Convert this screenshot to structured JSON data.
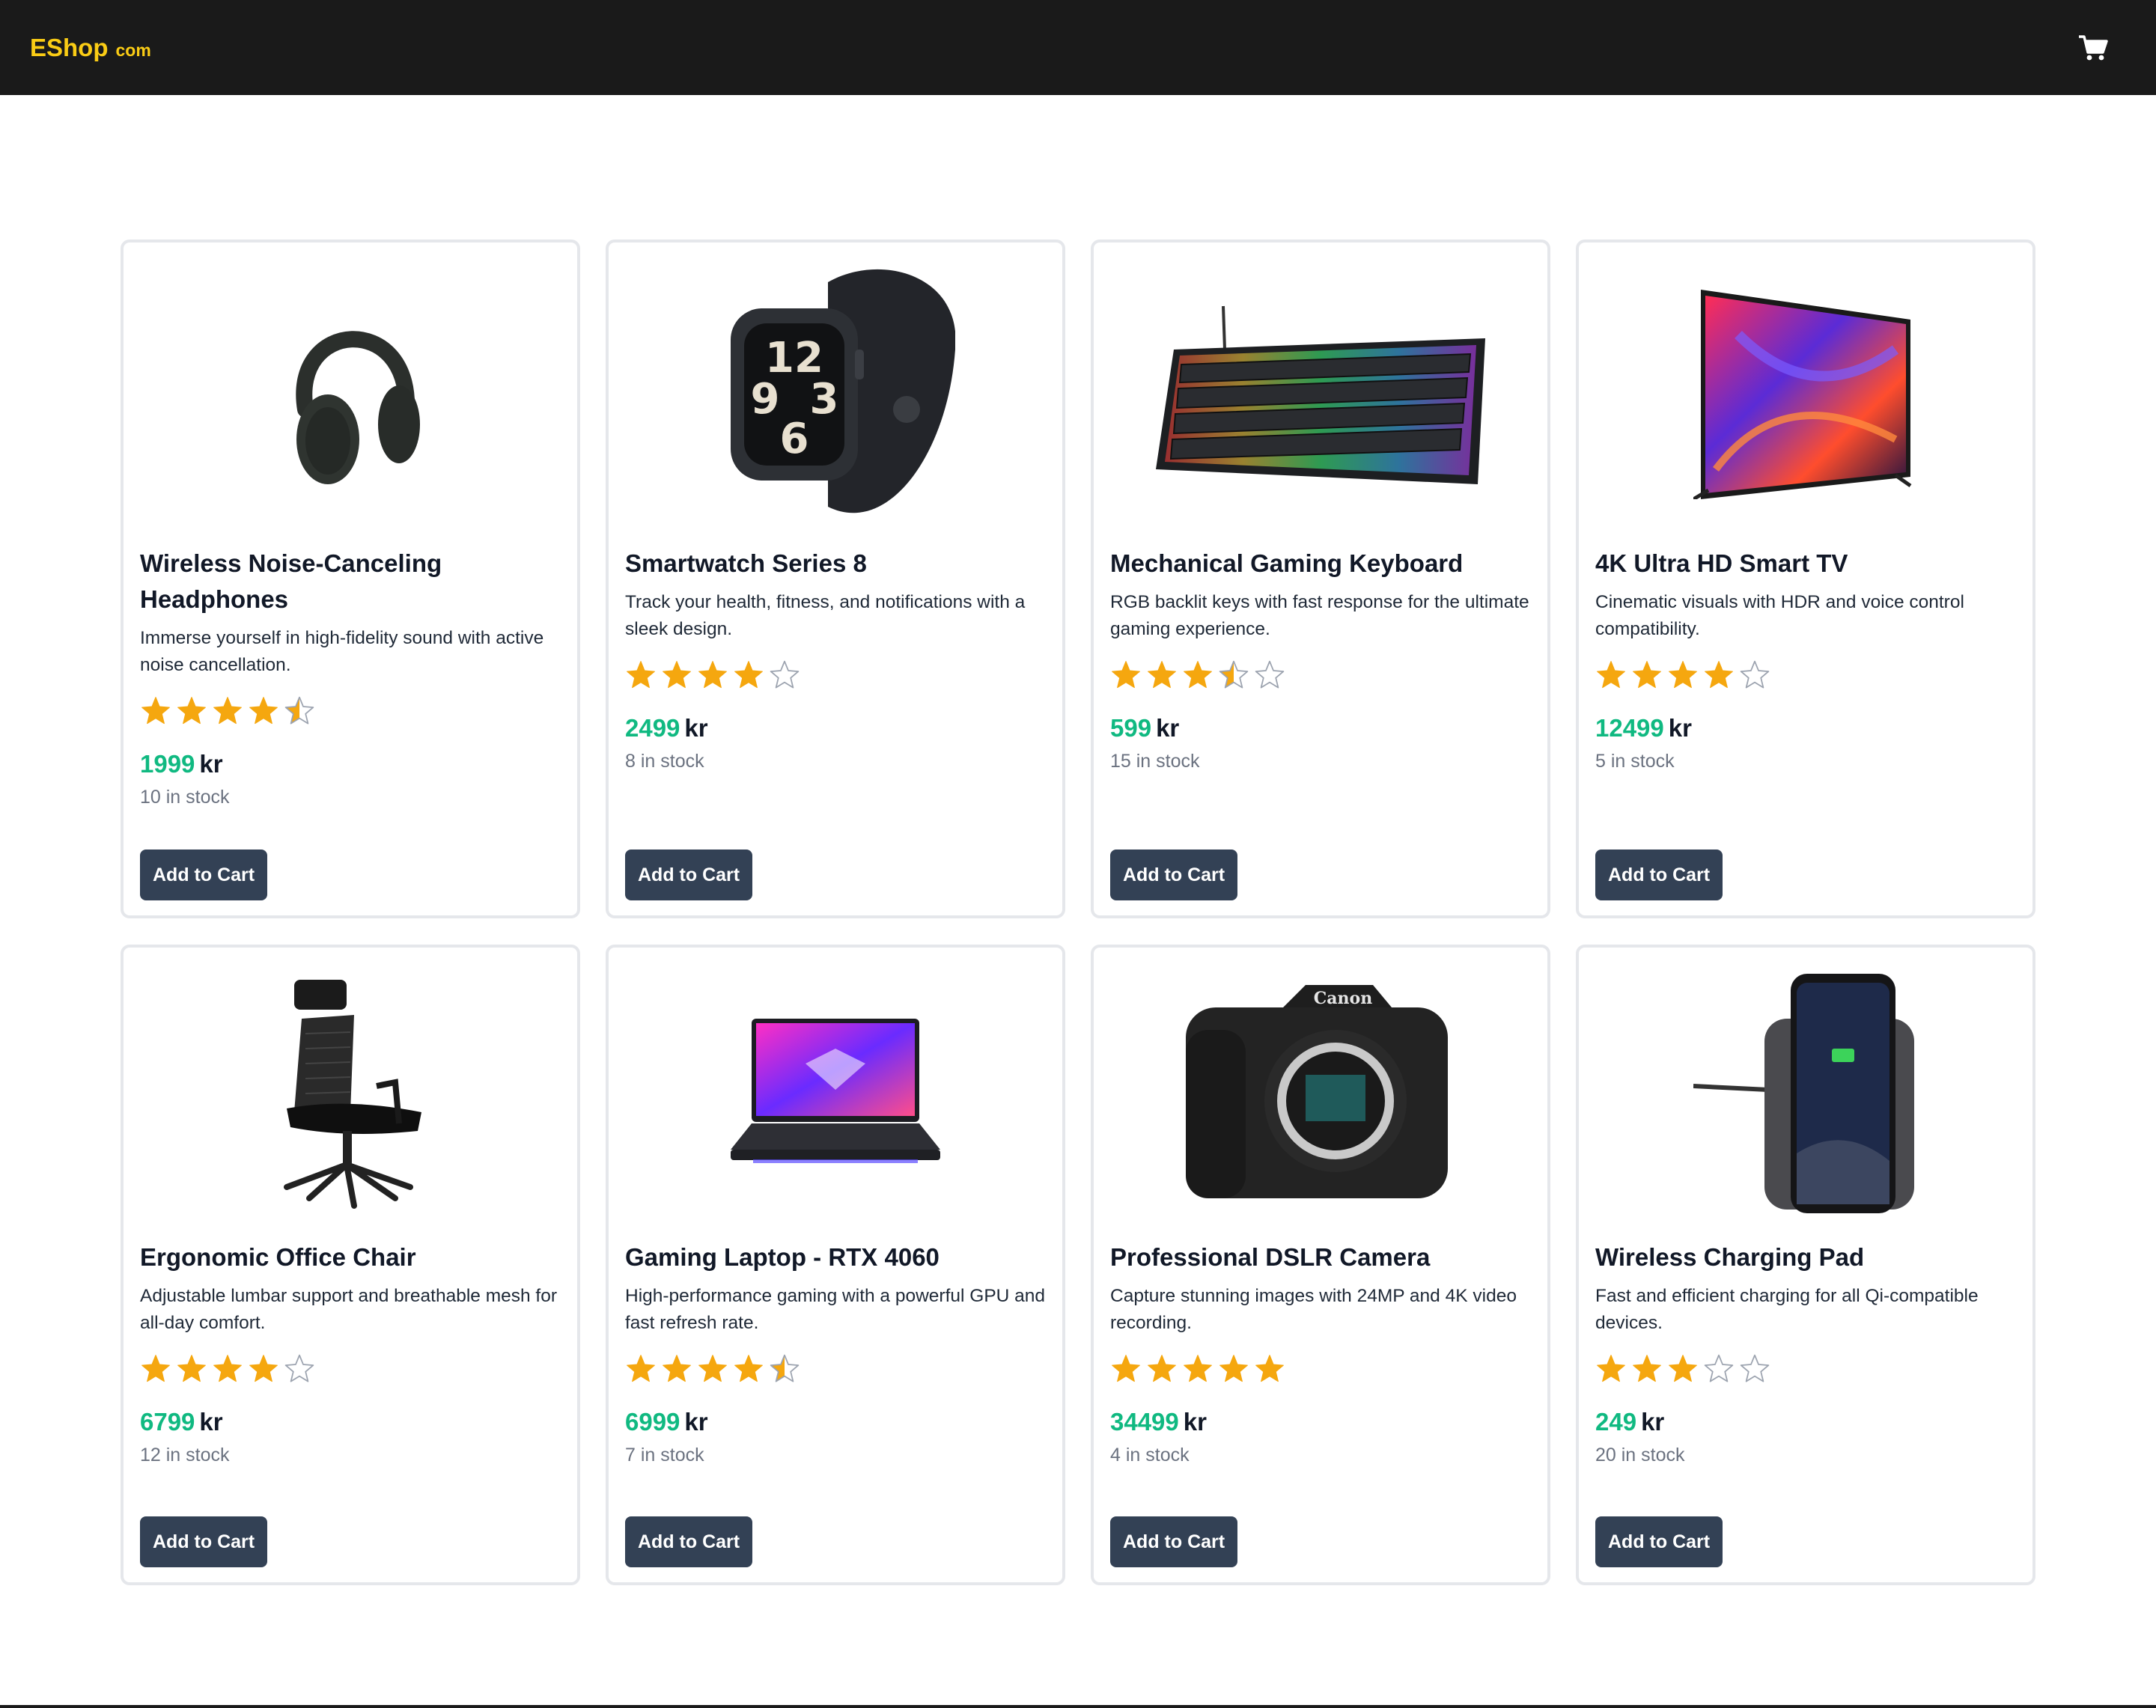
{
  "brand": {
    "name": "EShop",
    "suffix": "com"
  },
  "colors": {
    "accent": "#facc15",
    "price": "#10b981",
    "button": "#334155",
    "star": "#f5a70f"
  },
  "add_to_cart_label": "Add to Cart",
  "currency": "kr",
  "products": [
    {
      "title": "Wireless Noise-Canceling Headphones",
      "description": "Immerse yourself in high-fidelity sound with active noise cancellation.",
      "rating": 4.5,
      "price": "1999",
      "stock": "10 in stock",
      "icon": "headphones-icon"
    },
    {
      "title": "Smartwatch Series 8",
      "description": "Track your health, fitness, and notifications with a sleek design.",
      "rating": 4,
      "price": "2499",
      "stock": "8 in stock",
      "icon": "smartwatch-icon"
    },
    {
      "title": "Mechanical Gaming Keyboard",
      "description": "RGB backlit keys with fast response for the ultimate gaming experience.",
      "rating": 3.5,
      "price": "599",
      "stock": "15 in stock",
      "icon": "keyboard-icon"
    },
    {
      "title": "4K Ultra HD Smart TV",
      "description": "Cinematic visuals with HDR and voice control compatibility.",
      "rating": 4,
      "price": "12499",
      "stock": "5 in stock",
      "icon": "tv-icon"
    },
    {
      "title": "Ergonomic Office Chair",
      "description": "Adjustable lumbar support and breathable mesh for all-day comfort.",
      "rating": 4,
      "price": "6799",
      "stock": "12 in stock",
      "icon": "office-chair-icon"
    },
    {
      "title": "Gaming Laptop - RTX 4060",
      "description": "High-performance gaming with a powerful GPU and fast refresh rate.",
      "rating": 4.5,
      "price": "6999",
      "stock": "7 in stock",
      "icon": "laptop-icon"
    },
    {
      "title": "Professional DSLR Camera",
      "description": "Capture stunning images with 24MP and 4K video recording.",
      "rating": 5,
      "price": "34499",
      "stock": "4 in stock",
      "icon": "camera-icon"
    },
    {
      "title": "Wireless Charging Pad",
      "description": "Fast and efficient charging for all Qi-compatible devices.",
      "rating": 3,
      "price": "249",
      "stock": "20 in stock",
      "icon": "charging-pad-icon"
    }
  ]
}
